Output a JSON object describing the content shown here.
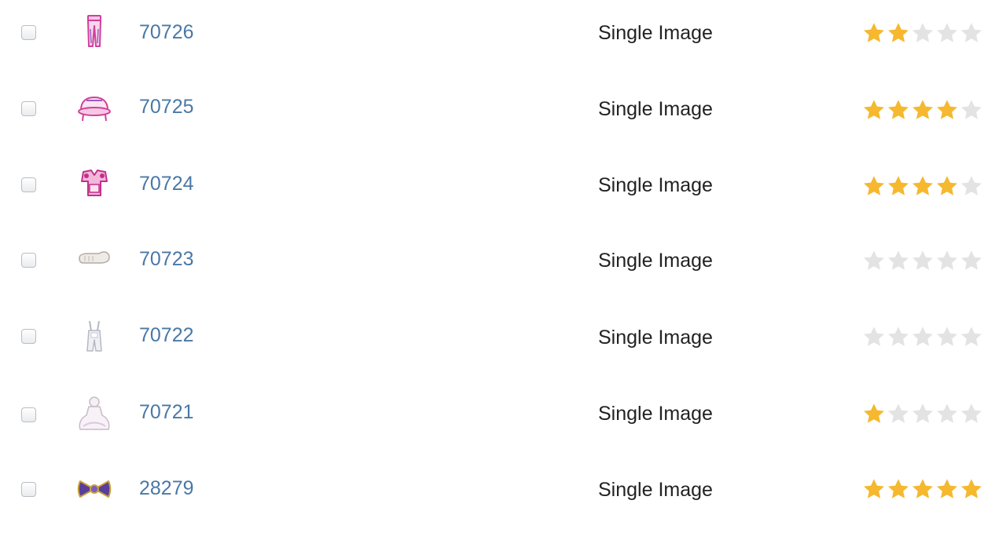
{
  "colors": {
    "link": "#4a78a6",
    "text": "#222222",
    "star_on": "#f5b82e",
    "star_off": "#e3e3e3",
    "checkbox_border": "#b9bec5"
  },
  "rows": [
    {
      "id": "70726",
      "type": "Single Image",
      "rating": 2,
      "max_rating": 5,
      "thumb_icon": "pink-pants-icon"
    },
    {
      "id": "70725",
      "type": "Single Image",
      "rating": 4,
      "max_rating": 5,
      "thumb_icon": "pink-hat-icon"
    },
    {
      "id": "70724",
      "type": "Single Image",
      "rating": 4,
      "max_rating": 5,
      "thumb_icon": "pink-top-icon"
    },
    {
      "id": "70723",
      "type": "Single Image",
      "rating": 0,
      "max_rating": 5,
      "thumb_icon": "grey-shoe-icon"
    },
    {
      "id": "70722",
      "type": "Single Image",
      "rating": 0,
      "max_rating": 5,
      "thumb_icon": "pale-overalls-icon"
    },
    {
      "id": "70721",
      "type": "Single Image",
      "rating": 1,
      "max_rating": 5,
      "thumb_icon": "white-dress-icon"
    },
    {
      "id": "28279",
      "type": "Single Image",
      "rating": 5,
      "max_rating": 5,
      "thumb_icon": "purple-bow-icon"
    }
  ]
}
